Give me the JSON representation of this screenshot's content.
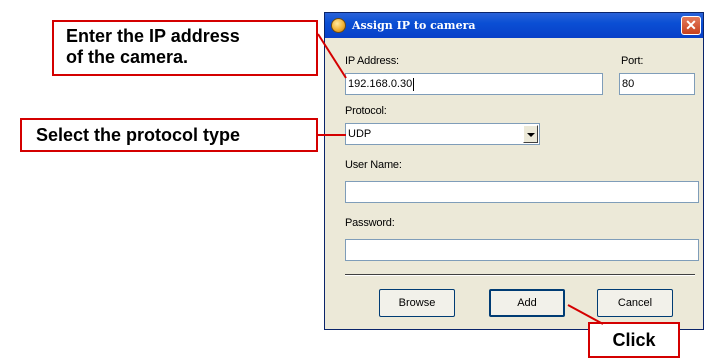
{
  "dialog": {
    "title": "Assign IP to camera",
    "close_symbol": "✕",
    "ip_label": "IP Address:",
    "ip_value": "192.168.0.30",
    "port_label": "Port:",
    "port_value": "80",
    "protocol_label": "Protocol:",
    "protocol_value": "UDP",
    "username_label": "User Name:",
    "username_value": "",
    "password_label": "Password:",
    "password_value": "",
    "buttons": {
      "browse": "Browse",
      "add": "Add",
      "cancel": "Cancel"
    }
  },
  "callouts": {
    "ip_line1": "Enter the IP address",
    "ip_line2": "of the camera.",
    "protocol": "Select the protocol type",
    "click": "Click"
  },
  "colors": {
    "callout_border": "#d40000",
    "titlebar": "#0a4fd4",
    "dialog_bg": "#ece9d8"
  }
}
